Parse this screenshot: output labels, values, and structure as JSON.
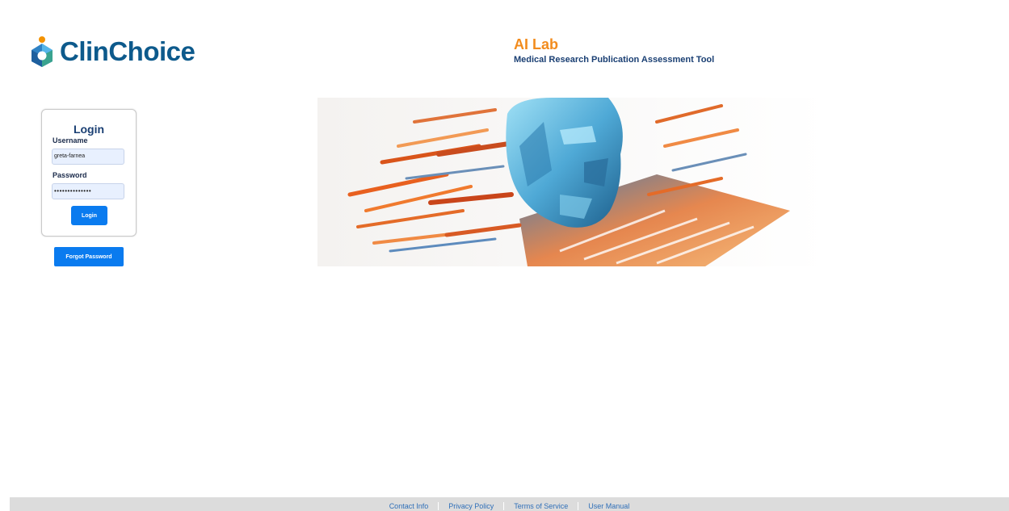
{
  "brand": {
    "logo_text": "ClinChoice",
    "logo_icon": "clinchoice-logo-icon"
  },
  "header": {
    "title": "AI Lab",
    "subtitle": "Medical Research Publication Assessment Tool"
  },
  "login": {
    "title": "Login",
    "username_label": "Username",
    "username_value": "greta-farnea",
    "password_label": "Password",
    "password_value": "••••••••••••••",
    "submit_label": "Login"
  },
  "forgot_password_label": "Forgot Password",
  "footer": {
    "links": [
      {
        "label": "Contact Info"
      },
      {
        "label": "Privacy Policy"
      },
      {
        "label": "Terms of Service"
      },
      {
        "label": "User Manual"
      }
    ]
  },
  "colors": {
    "accent": "#0a7bef",
    "title_orange": "#f28c1e",
    "navy": "#1a3f73",
    "footer_bg": "#dcdcdc",
    "link": "#2f6fb8"
  }
}
